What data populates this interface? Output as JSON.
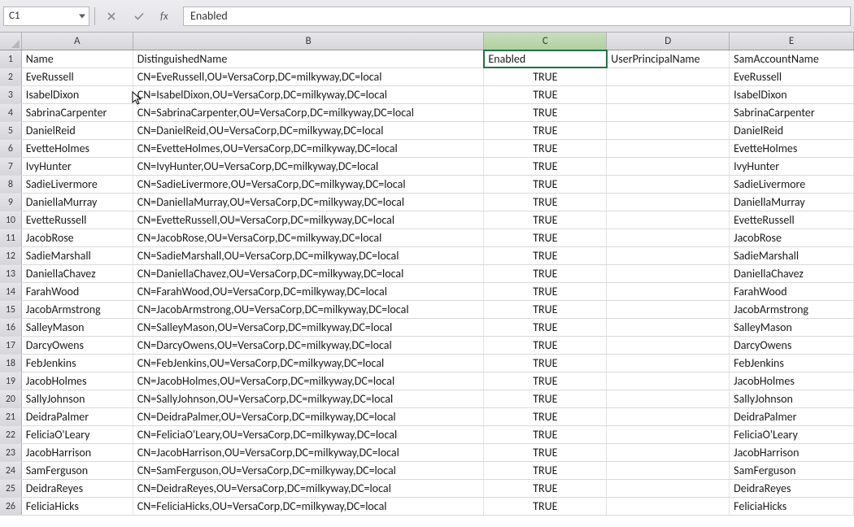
{
  "nameBox": "C1",
  "formulaValue": "Enabled",
  "columnLetters": [
    "A",
    "B",
    "C",
    "D",
    "E"
  ],
  "selectedCell": "C1",
  "headers": {
    "A": "Name",
    "B": "DistinguishedName",
    "C": "Enabled",
    "D": "UserPrincipalName",
    "E": "SamAccountName"
  },
  "chart_data": {
    "type": "table",
    "title": "",
    "columns": [
      "Name",
      "DistinguishedName",
      "Enabled",
      "UserPrincipalName",
      "SamAccountName"
    ],
    "rows": [
      {
        "Name": "EveRussell",
        "DistinguishedName": "CN=EveRussell,OU=VersaCorp,DC=milkyway,DC=local",
        "Enabled": "TRUE",
        "UserPrincipalName": "",
        "SamAccountName": "EveRussell"
      },
      {
        "Name": "IsabelDixon",
        "DistinguishedName": "CN=IsabelDixon,OU=VersaCorp,DC=milkyway,DC=local",
        "Enabled": "TRUE",
        "UserPrincipalName": "",
        "SamAccountName": "IsabelDixon"
      },
      {
        "Name": "SabrinaCarpenter",
        "DistinguishedName": "CN=SabrinaCarpenter,OU=VersaCorp,DC=milkyway,DC=local",
        "Enabled": "TRUE",
        "UserPrincipalName": "",
        "SamAccountName": "SabrinaCarpenter"
      },
      {
        "Name": "DanielReid",
        "DistinguishedName": "CN=DanielReid,OU=VersaCorp,DC=milkyway,DC=local",
        "Enabled": "TRUE",
        "UserPrincipalName": "",
        "SamAccountName": "DanielReid"
      },
      {
        "Name": "EvetteHolmes",
        "DistinguishedName": "CN=EvetteHolmes,OU=VersaCorp,DC=milkyway,DC=local",
        "Enabled": "TRUE",
        "UserPrincipalName": "",
        "SamAccountName": "EvetteHolmes"
      },
      {
        "Name": "IvyHunter",
        "DistinguishedName": "CN=IvyHunter,OU=VersaCorp,DC=milkyway,DC=local",
        "Enabled": "TRUE",
        "UserPrincipalName": "",
        "SamAccountName": "IvyHunter"
      },
      {
        "Name": "SadieLivermore",
        "DistinguishedName": "CN=SadieLivermore,OU=VersaCorp,DC=milkyway,DC=local",
        "Enabled": "TRUE",
        "UserPrincipalName": "",
        "SamAccountName": "SadieLivermore"
      },
      {
        "Name": "DaniellaMurray",
        "DistinguishedName": "CN=DaniellaMurray,OU=VersaCorp,DC=milkyway,DC=local",
        "Enabled": "TRUE",
        "UserPrincipalName": "",
        "SamAccountName": "DaniellaMurray"
      },
      {
        "Name": "EvetteRussell",
        "DistinguishedName": "CN=EvetteRussell,OU=VersaCorp,DC=milkyway,DC=local",
        "Enabled": "TRUE",
        "UserPrincipalName": "",
        "SamAccountName": "EvetteRussell"
      },
      {
        "Name": "JacobRose",
        "DistinguishedName": "CN=JacobRose,OU=VersaCorp,DC=milkyway,DC=local",
        "Enabled": "TRUE",
        "UserPrincipalName": "",
        "SamAccountName": "JacobRose"
      },
      {
        "Name": "SadieMarshall",
        "DistinguishedName": "CN=SadieMarshall,OU=VersaCorp,DC=milkyway,DC=local",
        "Enabled": "TRUE",
        "UserPrincipalName": "",
        "SamAccountName": "SadieMarshall"
      },
      {
        "Name": "DaniellaChavez",
        "DistinguishedName": "CN=DaniellaChavez,OU=VersaCorp,DC=milkyway,DC=local",
        "Enabled": "TRUE",
        "UserPrincipalName": "",
        "SamAccountName": "DaniellaChavez"
      },
      {
        "Name": "FarahWood",
        "DistinguishedName": "CN=FarahWood,OU=VersaCorp,DC=milkyway,DC=local",
        "Enabled": "TRUE",
        "UserPrincipalName": "",
        "SamAccountName": "FarahWood"
      },
      {
        "Name": "JacobArmstrong",
        "DistinguishedName": "CN=JacobArmstrong,OU=VersaCorp,DC=milkyway,DC=local",
        "Enabled": "TRUE",
        "UserPrincipalName": "",
        "SamAccountName": "JacobArmstrong"
      },
      {
        "Name": "SalleyMason",
        "DistinguishedName": "CN=SalleyMason,OU=VersaCorp,DC=milkyway,DC=local",
        "Enabled": "TRUE",
        "UserPrincipalName": "",
        "SamAccountName": "SalleyMason"
      },
      {
        "Name": "DarcyOwens",
        "DistinguishedName": "CN=DarcyOwens,OU=VersaCorp,DC=milkyway,DC=local",
        "Enabled": "TRUE",
        "UserPrincipalName": "",
        "SamAccountName": "DarcyOwens"
      },
      {
        "Name": "FebJenkins",
        "DistinguishedName": "CN=FebJenkins,OU=VersaCorp,DC=milkyway,DC=local",
        "Enabled": "TRUE",
        "UserPrincipalName": "",
        "SamAccountName": "FebJenkins"
      },
      {
        "Name": "JacobHolmes",
        "DistinguishedName": "CN=JacobHolmes,OU=VersaCorp,DC=milkyway,DC=local",
        "Enabled": "TRUE",
        "UserPrincipalName": "",
        "SamAccountName": "JacobHolmes"
      },
      {
        "Name": "SallyJohnson",
        "DistinguishedName": "CN=SallyJohnson,OU=VersaCorp,DC=milkyway,DC=local",
        "Enabled": "TRUE",
        "UserPrincipalName": "",
        "SamAccountName": "SallyJohnson"
      },
      {
        "Name": "DeidraPalmer",
        "DistinguishedName": "CN=DeidraPalmer,OU=VersaCorp,DC=milkyway,DC=local",
        "Enabled": "TRUE",
        "UserPrincipalName": "",
        "SamAccountName": "DeidraPalmer"
      },
      {
        "Name": "FeliciaO'Leary",
        "DistinguishedName": "CN=FeliciaO'Leary,OU=VersaCorp,DC=milkyway,DC=local",
        "Enabled": "TRUE",
        "UserPrincipalName": "",
        "SamAccountName": "FeliciaO'Leary"
      },
      {
        "Name": "JacobHarrison",
        "DistinguishedName": "CN=JacobHarrison,OU=VersaCorp,DC=milkyway,DC=local",
        "Enabled": "TRUE",
        "UserPrincipalName": "",
        "SamAccountName": "JacobHarrison"
      },
      {
        "Name": "SamFerguson",
        "DistinguishedName": "CN=SamFerguson,OU=VersaCorp,DC=milkyway,DC=local",
        "Enabled": "TRUE",
        "UserPrincipalName": "",
        "SamAccountName": "SamFerguson"
      },
      {
        "Name": "DeidraReyes",
        "DistinguishedName": "CN=DeidraReyes,OU=VersaCorp,DC=milkyway,DC=local",
        "Enabled": "TRUE",
        "UserPrincipalName": "",
        "SamAccountName": "DeidraReyes"
      },
      {
        "Name": "FeliciaHicks",
        "DistinguishedName": "CN=FeliciaHicks,OU=VersaCorp,DC=milkyway,DC=local",
        "Enabled": "TRUE",
        "UserPrincipalName": "",
        "SamAccountName": "FeliciaHicks"
      }
    ]
  }
}
